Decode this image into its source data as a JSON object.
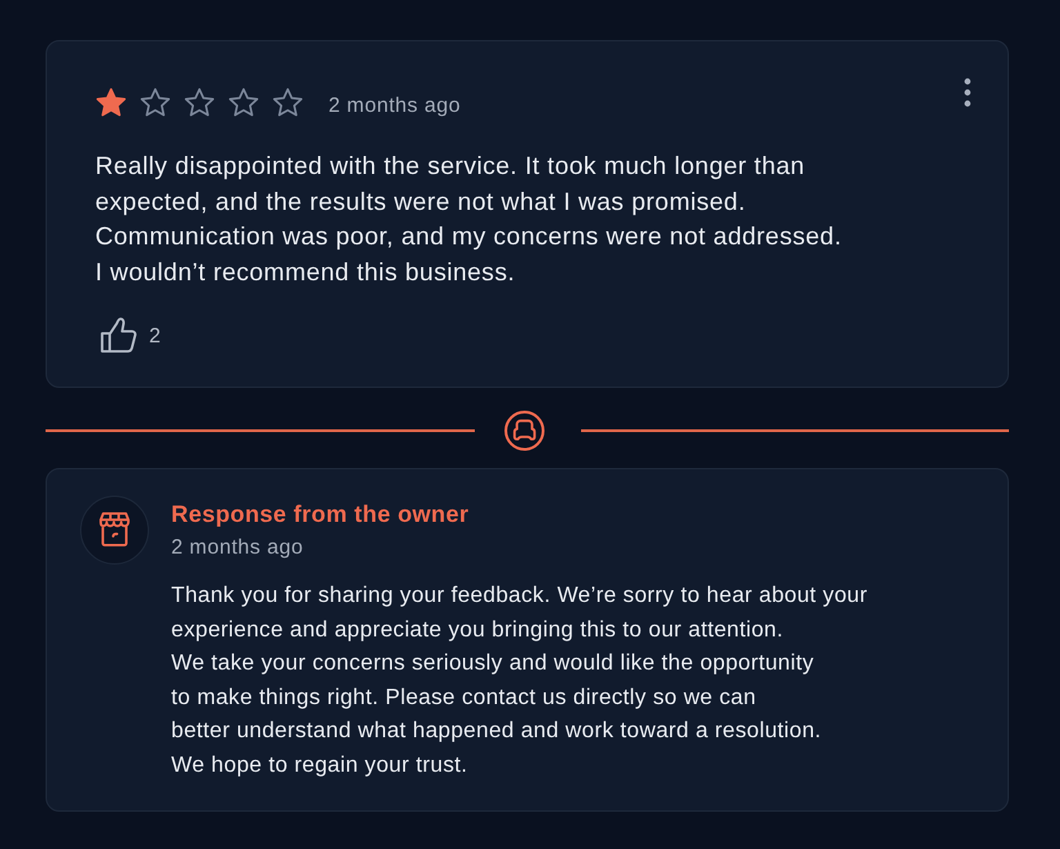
{
  "review": {
    "stars": 1,
    "time": "2 months ago",
    "text": "Really disappointed with the service. It took much longer than\nexpected, and the results were not what I was promised.\nCommunication was poor, and my concerns were not addressed.\nI wouldn’t recommend this business.",
    "likes": "2"
  },
  "owner_response": {
    "title": "Response from the owner",
    "time": "2 months ago",
    "text": "Thank you for sharing your feedback. We’re sorry to hear about your\nexperience and appreciate you bringing this to our attention.\nWe take your concerns seriously and would like the opportunity\nto make things right. Please contact us directly so we can\nbetter understand what happened and work toward a resolution.\nWe hope to regain your trust."
  }
}
